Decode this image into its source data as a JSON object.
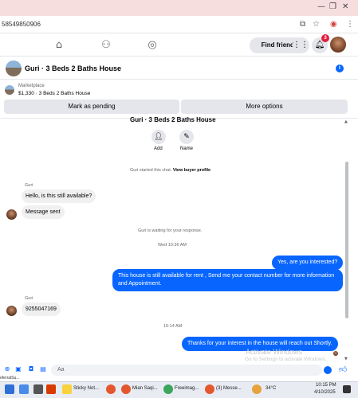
{
  "browser": {
    "url_fragment": "58549850906",
    "icons": [
      "cast-icon",
      "star-icon",
      "extension-icon",
      "profile-icon",
      "menu-icon"
    ]
  },
  "fb_nav": {
    "find_friends": "Find friends",
    "notification_count": "3"
  },
  "chat": {
    "title": "Guri · 3 Beds 2 Baths House",
    "marketplace_label": "Marketplace",
    "listing_line": "$1,330 · 3 Beds 2 Baths House",
    "mark_pending": "Mark as pending",
    "more_options": "More options",
    "profile_name": "Guri · 3 Beds 2 Baths House",
    "actions": [
      {
        "label": "Add",
        "icon": "add-person-icon"
      },
      {
        "label": "Name",
        "icon": "pencil-icon"
      }
    ],
    "started_text": "Guri started this chat.",
    "view_buyer_profile": "View buyer profile"
  },
  "messages": {
    "sender1": "Guri",
    "m1": "Hello, is this still available?",
    "m2": "Message sent",
    "waiting": "Guri is waiting for your response.",
    "time1": "Wed 10:36 AM",
    "m3": "Yes, are you interested?",
    "m4": "This house is still available for rent , Send me your contact number for more information and Appointment.",
    "sender2": "Guri",
    "m5": "9255047169",
    "time2": "10:14 AM",
    "m6": "Thanks for your interest in the house will reach out Shortly."
  },
  "composer": {
    "placeholder": "Aa"
  },
  "watermark": {
    "line1": "Activate Windows",
    "line2": "Go to Settings to activate Windows."
  },
  "left_clip": "eferralSu...",
  "taskbar": {
    "apps": [
      {
        "label": "Sticky Not...",
        "color": "#f7d23e"
      },
      {
        "label": "Mian Saqi...",
        "color": "#e4572e"
      },
      {
        "label": "Freeimag...",
        "color": "#3ba55d"
      },
      {
        "label": "(3) Messe...",
        "color": "#e4572e"
      }
    ],
    "weather": "34°C",
    "time": "10:15 PM",
    "date": "4/10/2025"
  },
  "colors": {
    "accent": "#0866ff",
    "bubble_in": "#f0f0f0",
    "badge": "#e41e3f"
  }
}
